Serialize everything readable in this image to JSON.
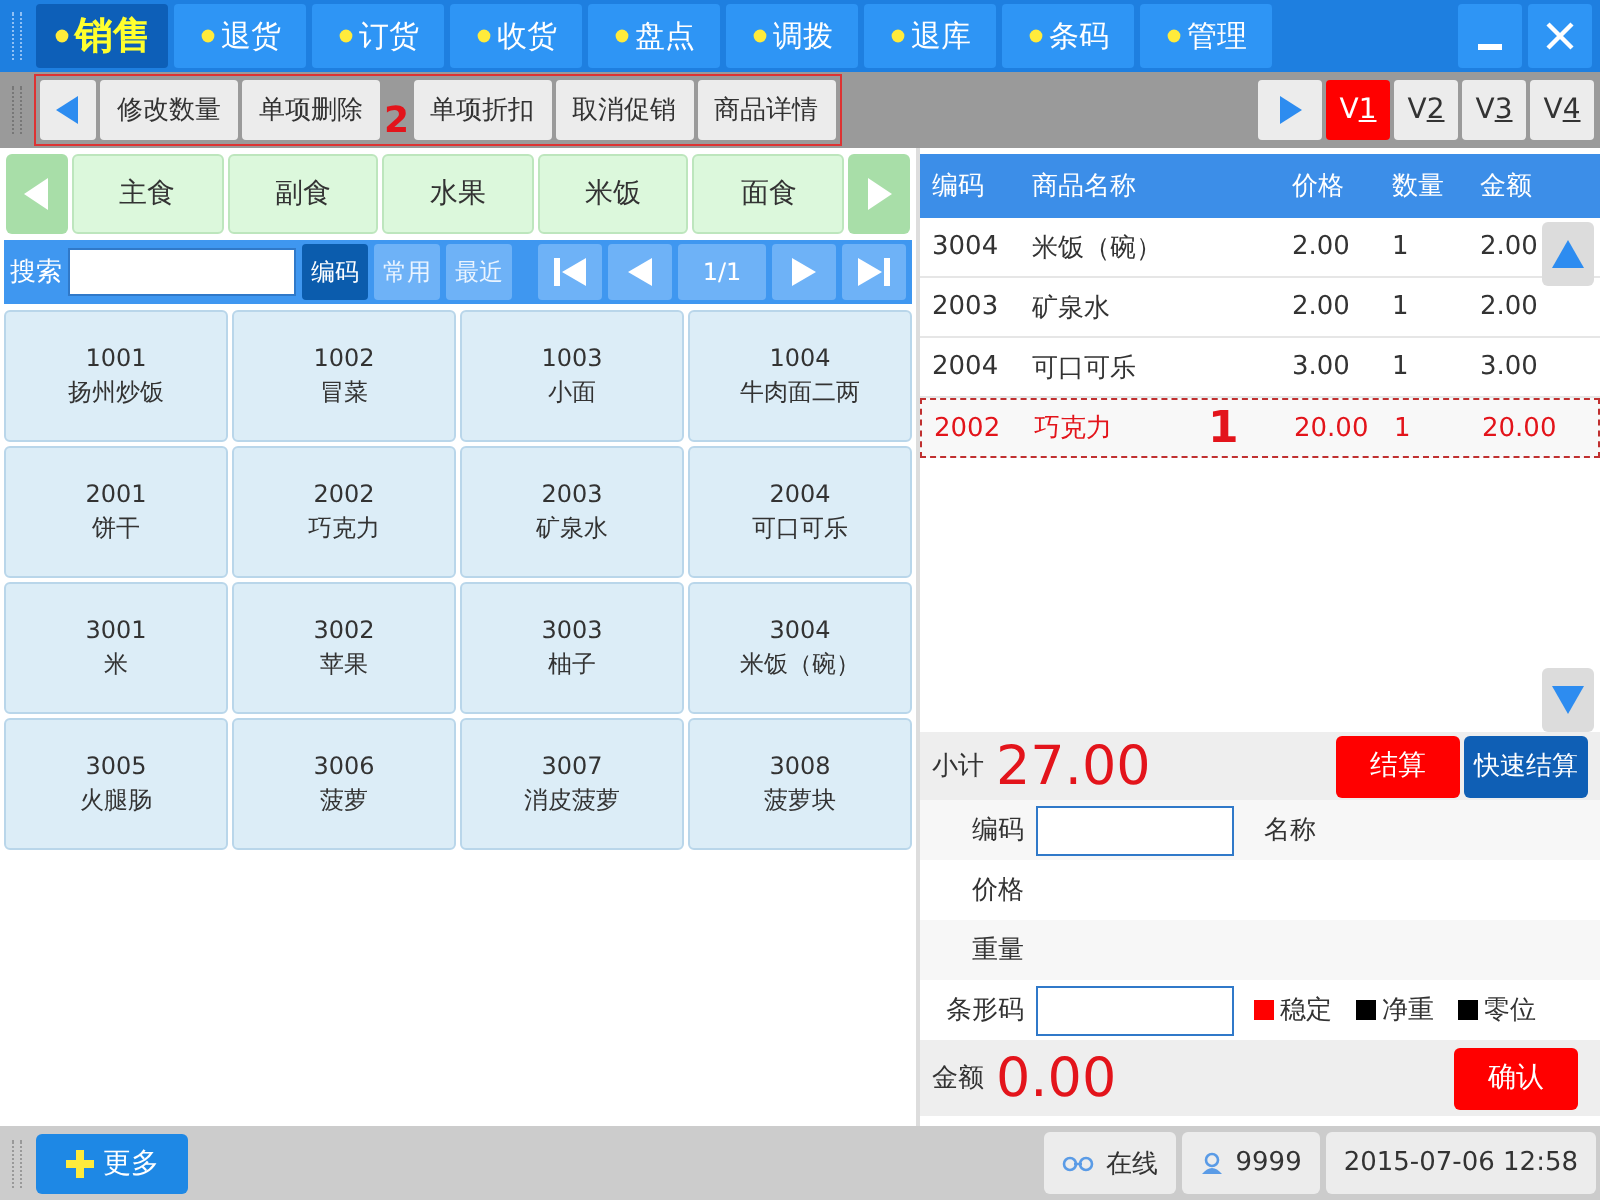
{
  "menu": {
    "tabs": [
      {
        "label": "销售",
        "selected": true
      },
      {
        "label": "退货",
        "selected": false
      },
      {
        "label": "订货",
        "selected": false
      },
      {
        "label": "收货",
        "selected": false
      },
      {
        "label": "盘点",
        "selected": false
      },
      {
        "label": "调拨",
        "selected": false
      },
      {
        "label": "退库",
        "selected": false
      },
      {
        "label": "条码",
        "selected": false
      },
      {
        "label": "管理",
        "selected": false
      }
    ]
  },
  "toolbar": {
    "annotation": "2",
    "buttons": [
      "修改数量",
      "单项删除",
      "单项折扣",
      "取消促销",
      "商品详情"
    ],
    "versions": [
      {
        "prefix": "V",
        "key": "1",
        "selected": true
      },
      {
        "prefix": "V",
        "key": "2",
        "selected": false
      },
      {
        "prefix": "V",
        "key": "3",
        "selected": false
      },
      {
        "prefix": "V",
        "key": "4",
        "selected": false
      }
    ]
  },
  "categories": [
    "主食",
    "副食",
    "水果",
    "米饭",
    "面食"
  ],
  "search": {
    "label": "搜索",
    "modes": [
      {
        "label": "编码",
        "selected": true
      },
      {
        "label": "常用",
        "selected": false
      },
      {
        "label": "最近",
        "selected": false
      }
    ],
    "page": "1/1"
  },
  "products": [
    {
      "code": "1001",
      "name": "扬州炒饭"
    },
    {
      "code": "1002",
      "name": "冒菜"
    },
    {
      "code": "1003",
      "name": "小面"
    },
    {
      "code": "1004",
      "name": "牛肉面二两"
    },
    {
      "code": "2001",
      "name": "饼干"
    },
    {
      "code": "2002",
      "name": "巧克力"
    },
    {
      "code": "2003",
      "name": "矿泉水"
    },
    {
      "code": "2004",
      "name": "可口可乐"
    },
    {
      "code": "3001",
      "name": "米"
    },
    {
      "code": "3002",
      "name": "苹果"
    },
    {
      "code": "3003",
      "name": "柚子"
    },
    {
      "code": "3004",
      "name": "米饭（碗）"
    },
    {
      "code": "3005",
      "name": "火腿肠"
    },
    {
      "code": "3006",
      "name": "菠萝"
    },
    {
      "code": "3007",
      "name": "消皮菠萝"
    },
    {
      "code": "3008",
      "name": "菠萝块"
    }
  ],
  "order": {
    "columns": [
      "编码",
      "商品名称",
      "价格",
      "数量",
      "金额"
    ],
    "annotation": "1",
    "rows": [
      {
        "cells": [
          "3004",
          "米饭（碗）",
          "2.00",
          "1",
          "2.00"
        ],
        "selected": false
      },
      {
        "cells": [
          "2003",
          "矿泉水",
          "2.00",
          "1",
          "2.00"
        ],
        "selected": false
      },
      {
        "cells": [
          "2004",
          "可口可乐",
          "3.00",
          "1",
          "3.00"
        ],
        "selected": false
      },
      {
        "cells": [
          "2002",
          "巧克力",
          "20.00",
          "1",
          "20.00"
        ],
        "selected": true
      }
    ]
  },
  "subtotal": {
    "label": "小计",
    "value": "27.00",
    "settle": "结算",
    "quick_settle": "快速结算"
  },
  "form": {
    "code_label": "编码",
    "name_label": "名称",
    "price_label": "价格",
    "weight_label": "重量",
    "barcode_label": "条形码",
    "indicators": [
      {
        "label": "稳定",
        "color": "#ff0000"
      },
      {
        "label": "净重",
        "color": "#000000"
      },
      {
        "label": "零位",
        "color": "#000000"
      }
    ],
    "amount_label": "金额",
    "amount": "0.00",
    "confirm": "确认"
  },
  "status_bar": {
    "more": "更多",
    "online": "在线",
    "user": "9999",
    "time": "2015-07-06 12:58"
  }
}
